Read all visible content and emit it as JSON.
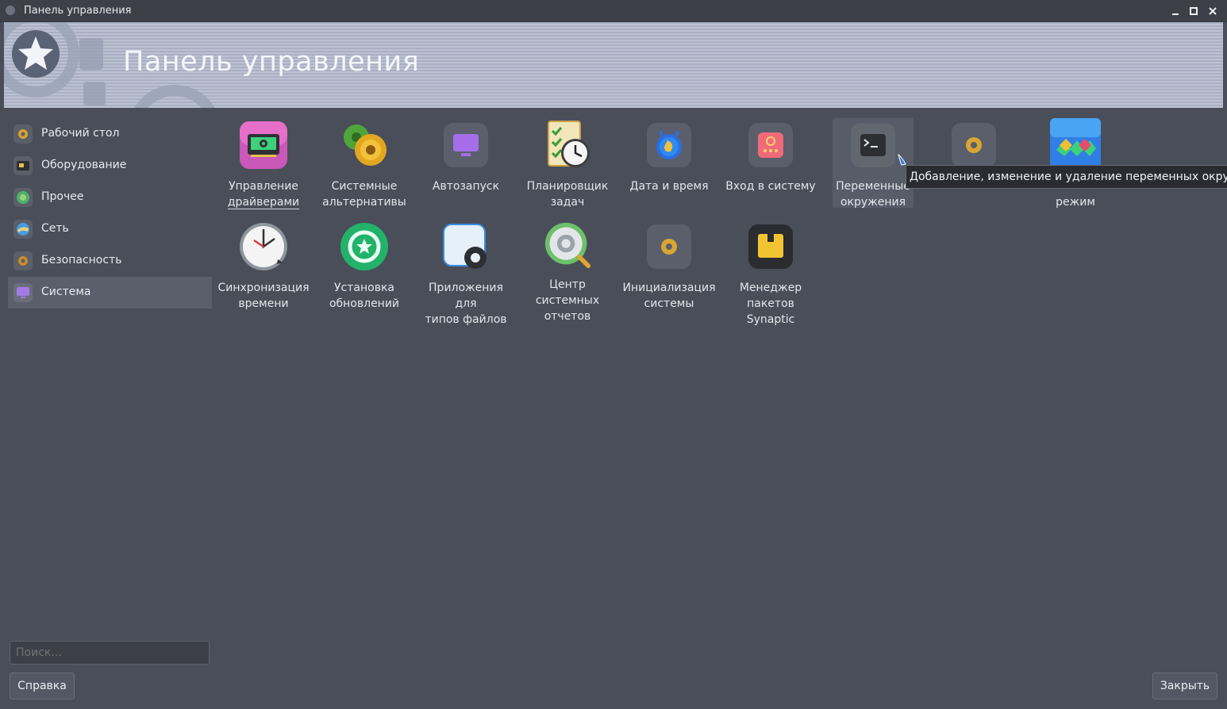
{
  "window": {
    "title": "Панель управления"
  },
  "banner": {
    "title": "Панель управления"
  },
  "sidebar": {
    "items": [
      {
        "label": "Рабочий стол",
        "color": "#c9a23a"
      },
      {
        "label": "Оборудование",
        "color": "#e6c14a"
      },
      {
        "label": "Прочее",
        "color": "#4bb56a"
      },
      {
        "label": "Сеть",
        "color": "#4a9be0"
      },
      {
        "label": "Безопасность",
        "color": "#c98c2b"
      },
      {
        "label": "Система",
        "color": "#9b6ce0"
      }
    ],
    "active": "Система"
  },
  "search": {
    "placeholder": "Поиск..."
  },
  "buttons": {
    "help": "Справка",
    "close": "Закрыть"
  },
  "tiles": [
    {
      "label1": "Управление",
      "label2": "драйверами",
      "icon": "driver-card-icon"
    },
    {
      "label1": "Системные",
      "label2": "альтернативы",
      "icon": "gears-icon"
    },
    {
      "label1": "Автозапуск",
      "label2": "",
      "icon": "monitor-icon"
    },
    {
      "label1": "Планировщик",
      "label2": "задач",
      "icon": "scheduler-icon"
    },
    {
      "label1": "Дата и время",
      "label2": "",
      "icon": "clock-icon"
    },
    {
      "label1": "Вход в систему",
      "label2": "",
      "icon": "login-icon"
    },
    {
      "label1": "Переменные",
      "label2": "окружения",
      "icon": "terminal-icon"
    },
    {
      "label1": "",
      "label2": "",
      "icon": "gear-icon"
    },
    {
      "label1": "",
      "label2": "режим",
      "icon": "mode-icon"
    },
    {
      "label1": "Синхронизация",
      "label2": "времени",
      "icon": "time-sync-icon"
    },
    {
      "label1": "Установка",
      "label2": "обновлений",
      "icon": "update-icon"
    },
    {
      "label1": "Приложения для",
      "label2": "типов файлов",
      "icon": "file-types-icon"
    },
    {
      "label1": "Центр",
      "label2": "системных",
      "label3": "отчетов",
      "icon": "report-center-icon"
    },
    {
      "label1": "Инициализация",
      "label2": "системы",
      "icon": "init-icon"
    },
    {
      "label1": "Менеджер",
      "label2": "пакетов Synaptic",
      "icon": "synaptic-icon"
    }
  ],
  "tooltip": {
    "text": "Добавление, изменение и удаление переменных окружен"
  }
}
